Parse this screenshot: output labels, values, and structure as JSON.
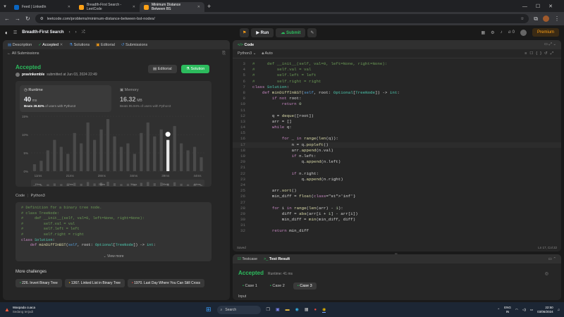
{
  "browser": {
    "tabs": [
      {
        "label": "Feed | LinkedIn",
        "active": false,
        "color": "#0a66c2"
      },
      {
        "label": "Breadth-First Search - LeetCode",
        "active": false,
        "color": "#ffa116"
      },
      {
        "label": "Minimum Distance Between BS",
        "active": true,
        "color": "#ffa116"
      }
    ],
    "url": "leetcode.com/problems/minimum-distance-between-bst-nodes/"
  },
  "lc_top": {
    "study_plan": "Breadth-First Search",
    "run_label": "Run",
    "submit_label": "Submit",
    "streak_count": "0",
    "premium_label": "Premium"
  },
  "left_tabs": [
    "Description",
    "Accepted",
    "Solutions",
    "Editorial",
    "Submissions"
  ],
  "submission": {
    "back_label": "All Submissions",
    "status": "Accepted",
    "user": "pravinkemble",
    "submitted_at": "submitted at Jun 03, 2024 22:49",
    "editorial_label": "Editorial",
    "solution_label": "Solution",
    "runtime_title": "Runtime",
    "runtime_value": "40",
    "runtime_unit": "ms",
    "runtime_beats": "Beats 28.82%",
    "runtime_beats_tail": "of users with Python3",
    "memory_title": "Memory",
    "memory_value": "16.32",
    "memory_unit": "MB",
    "memory_beats": "Beats 95.94%",
    "memory_beats_tail": "of users with Python3"
  },
  "chart_data": {
    "type": "bar",
    "y_ticks": [
      "15%",
      "10%",
      "5%",
      "0%"
    ],
    "x_ticks": [
      "11ms",
      "21ms",
      "28ms",
      "34ms",
      "39ms",
      "44ms"
    ],
    "values": [
      2,
      3,
      6,
      9,
      7,
      5,
      11,
      8,
      14,
      9,
      12,
      15,
      10,
      7,
      8,
      5,
      11,
      14,
      10,
      12,
      9,
      13,
      8,
      6,
      7,
      4
    ],
    "highlight_index": 20,
    "mini_ticks": [
      "15ms",
      "22ms",
      "28ms",
      "34ms",
      "39ms",
      "44ms"
    ]
  },
  "left_code": {
    "header": "Code",
    "lang": "Python3",
    "lines": [
      "# Definition for a binary tree node.",
      "# class TreeNode:",
      "#     def __init__(self, val=0, left=None, right=None):",
      "#         self.val = val",
      "#         self.left = left",
      "#         self.right = right",
      "class Solution:",
      "    def minDiffInBST(self, root: Optional[TreeNode]) -> int:"
    ],
    "view_more": "View more"
  },
  "more_challenges": {
    "title": "More challenges",
    "items": [
      "226. Invert Binary Tree",
      "1367. Linked List in Binary Tree",
      "1970. Last Day Where You Can Still Cross"
    ]
  },
  "editor": {
    "title": "Code",
    "lang": "Python3",
    "mode": "Auto",
    "saved": "Saved",
    "cursor": "Ln 17, Col 22",
    "lines": [
      {
        "n": "3",
        "t": "#     def __init__(self, val=0, left=None, right=None):"
      },
      {
        "n": "4",
        "t": "#         self.val = val"
      },
      {
        "n": "5",
        "t": "#         self.left = left"
      },
      {
        "n": "6",
        "t": "#         self.right = right"
      },
      {
        "n": "7",
        "t": "class Solution:"
      },
      {
        "n": "8",
        "t": "    def minDiffInBST(self, root: Optional[TreeNode]) -> int:"
      },
      {
        "n": "9",
        "t": "        if not root:"
      },
      {
        "n": "10",
        "t": "            return 0"
      },
      {
        "n": "11",
        "t": ""
      },
      {
        "n": "12",
        "t": "        q = deque([root])"
      },
      {
        "n": "13",
        "t": "        arr = []"
      },
      {
        "n": "14",
        "t": "        while q:"
      },
      {
        "n": "15",
        "t": ""
      },
      {
        "n": "16",
        "t": "            for _ in range(len(q)):"
      },
      {
        "n": "17",
        "t": "                n = q.popleft()"
      },
      {
        "n": "18",
        "t": "                arr.append(n.val)"
      },
      {
        "n": "19",
        "t": "                if n.left:"
      },
      {
        "n": "20",
        "t": "                    q.append(n.left)"
      },
      {
        "n": "21",
        "t": ""
      },
      {
        "n": "22",
        "t": "                if n.right:"
      },
      {
        "n": "23",
        "t": "                    q.append(n.right)"
      },
      {
        "n": "24",
        "t": ""
      },
      {
        "n": "25",
        "t": "        arr.sort()"
      },
      {
        "n": "26",
        "t": "        min_diff = float('inf')"
      },
      {
        "n": "27",
        "t": ""
      },
      {
        "n": "28",
        "t": "        for i in range(len(arr) - 1):"
      },
      {
        "n": "29",
        "t": "            diff = abs(arr[i + 1] - arr[i])"
      },
      {
        "n": "30",
        "t": "            min_diff = min(min_diff, diff)"
      },
      {
        "n": "31",
        "t": ""
      },
      {
        "n": "32",
        "t": "        return min_diff"
      }
    ]
  },
  "result": {
    "tab_testcase": "Testcase",
    "tab_result": "Test Result",
    "status": "Accepted",
    "runtime": "Runtime: 41 ms",
    "cases": [
      "Case 1",
      "Case 2",
      "Case 3"
    ],
    "input_label": "Input"
  },
  "taskbar": {
    "weather": "Waspada cuaca",
    "weather_sub": "Sedang terjadi",
    "search": "Search",
    "lang": "ENG",
    "region": "IN",
    "time": "22:50",
    "date": "03/06/2024"
  }
}
